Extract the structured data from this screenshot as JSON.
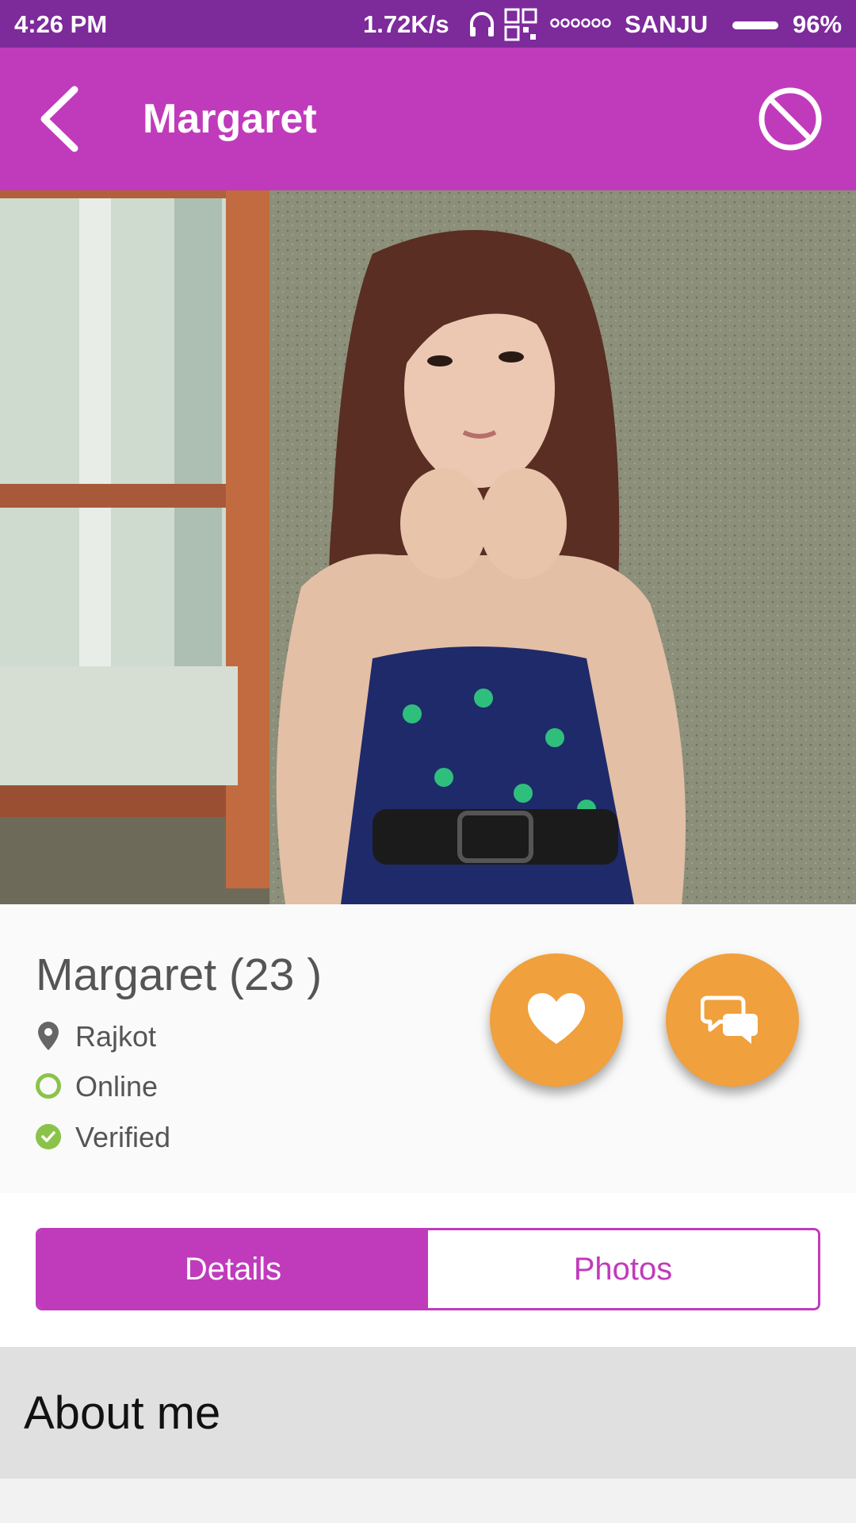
{
  "status_bar": {
    "time": "4:26 PM",
    "net_speed": "1.72K/s",
    "carrier": "SANJU",
    "battery": "96%",
    "icons": [
      "headphones-icon",
      "qr-icon",
      "signal-dots-icon",
      "battery-icon"
    ]
  },
  "app_bar": {
    "title": "Margaret",
    "back_icon": "chevron-left-icon",
    "block_icon": "block-icon",
    "color": "#c03bbb"
  },
  "profile": {
    "name_age": "Margaret (23 )",
    "location": "Rajkot",
    "status": "Online",
    "verified": "Verified",
    "status_color": "#8bc34a",
    "actions": [
      "heart-icon",
      "chat-bubbles-icon"
    ],
    "action_color": "#f0a03c"
  },
  "tabs": [
    {
      "label": "Details",
      "active": true
    },
    {
      "label": "Photos",
      "active": false
    }
  ],
  "about": {
    "title": "About me"
  }
}
